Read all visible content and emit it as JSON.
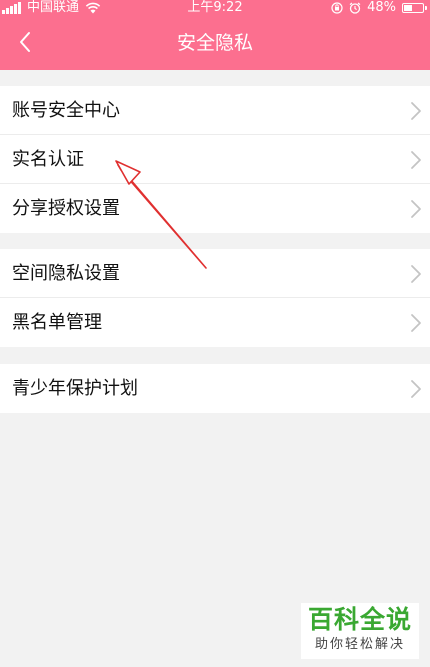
{
  "status_bar": {
    "carrier": "中国联通",
    "time": "上午9:22",
    "battery": "48%",
    "battery_level": 0.48,
    "signal_icon": "signal-icon",
    "wifi_icon": "wifi-icon",
    "lock_icon": "orientation-lock-icon",
    "alarm_icon": "alarm-icon"
  },
  "header": {
    "title": "安全隐私",
    "back_icon": "back-chevron-icon",
    "color": "#fc6f8f"
  },
  "groups": [
    {
      "items": [
        {
          "label": "账号安全中心"
        },
        {
          "label": "实名认证"
        },
        {
          "label": "分享授权设置"
        }
      ]
    },
    {
      "items": [
        {
          "label": "空间隐私设置"
        },
        {
          "label": "黑名单管理"
        }
      ]
    },
    {
      "items": [
        {
          "label": "青少年保护计划"
        }
      ]
    }
  ],
  "annotation": {
    "type": "arrow",
    "color": "#e03030",
    "points_to": "实名认证"
  },
  "watermark": {
    "main": "百科全说",
    "sub": "助你轻松解决",
    "color": "#3aa832"
  }
}
